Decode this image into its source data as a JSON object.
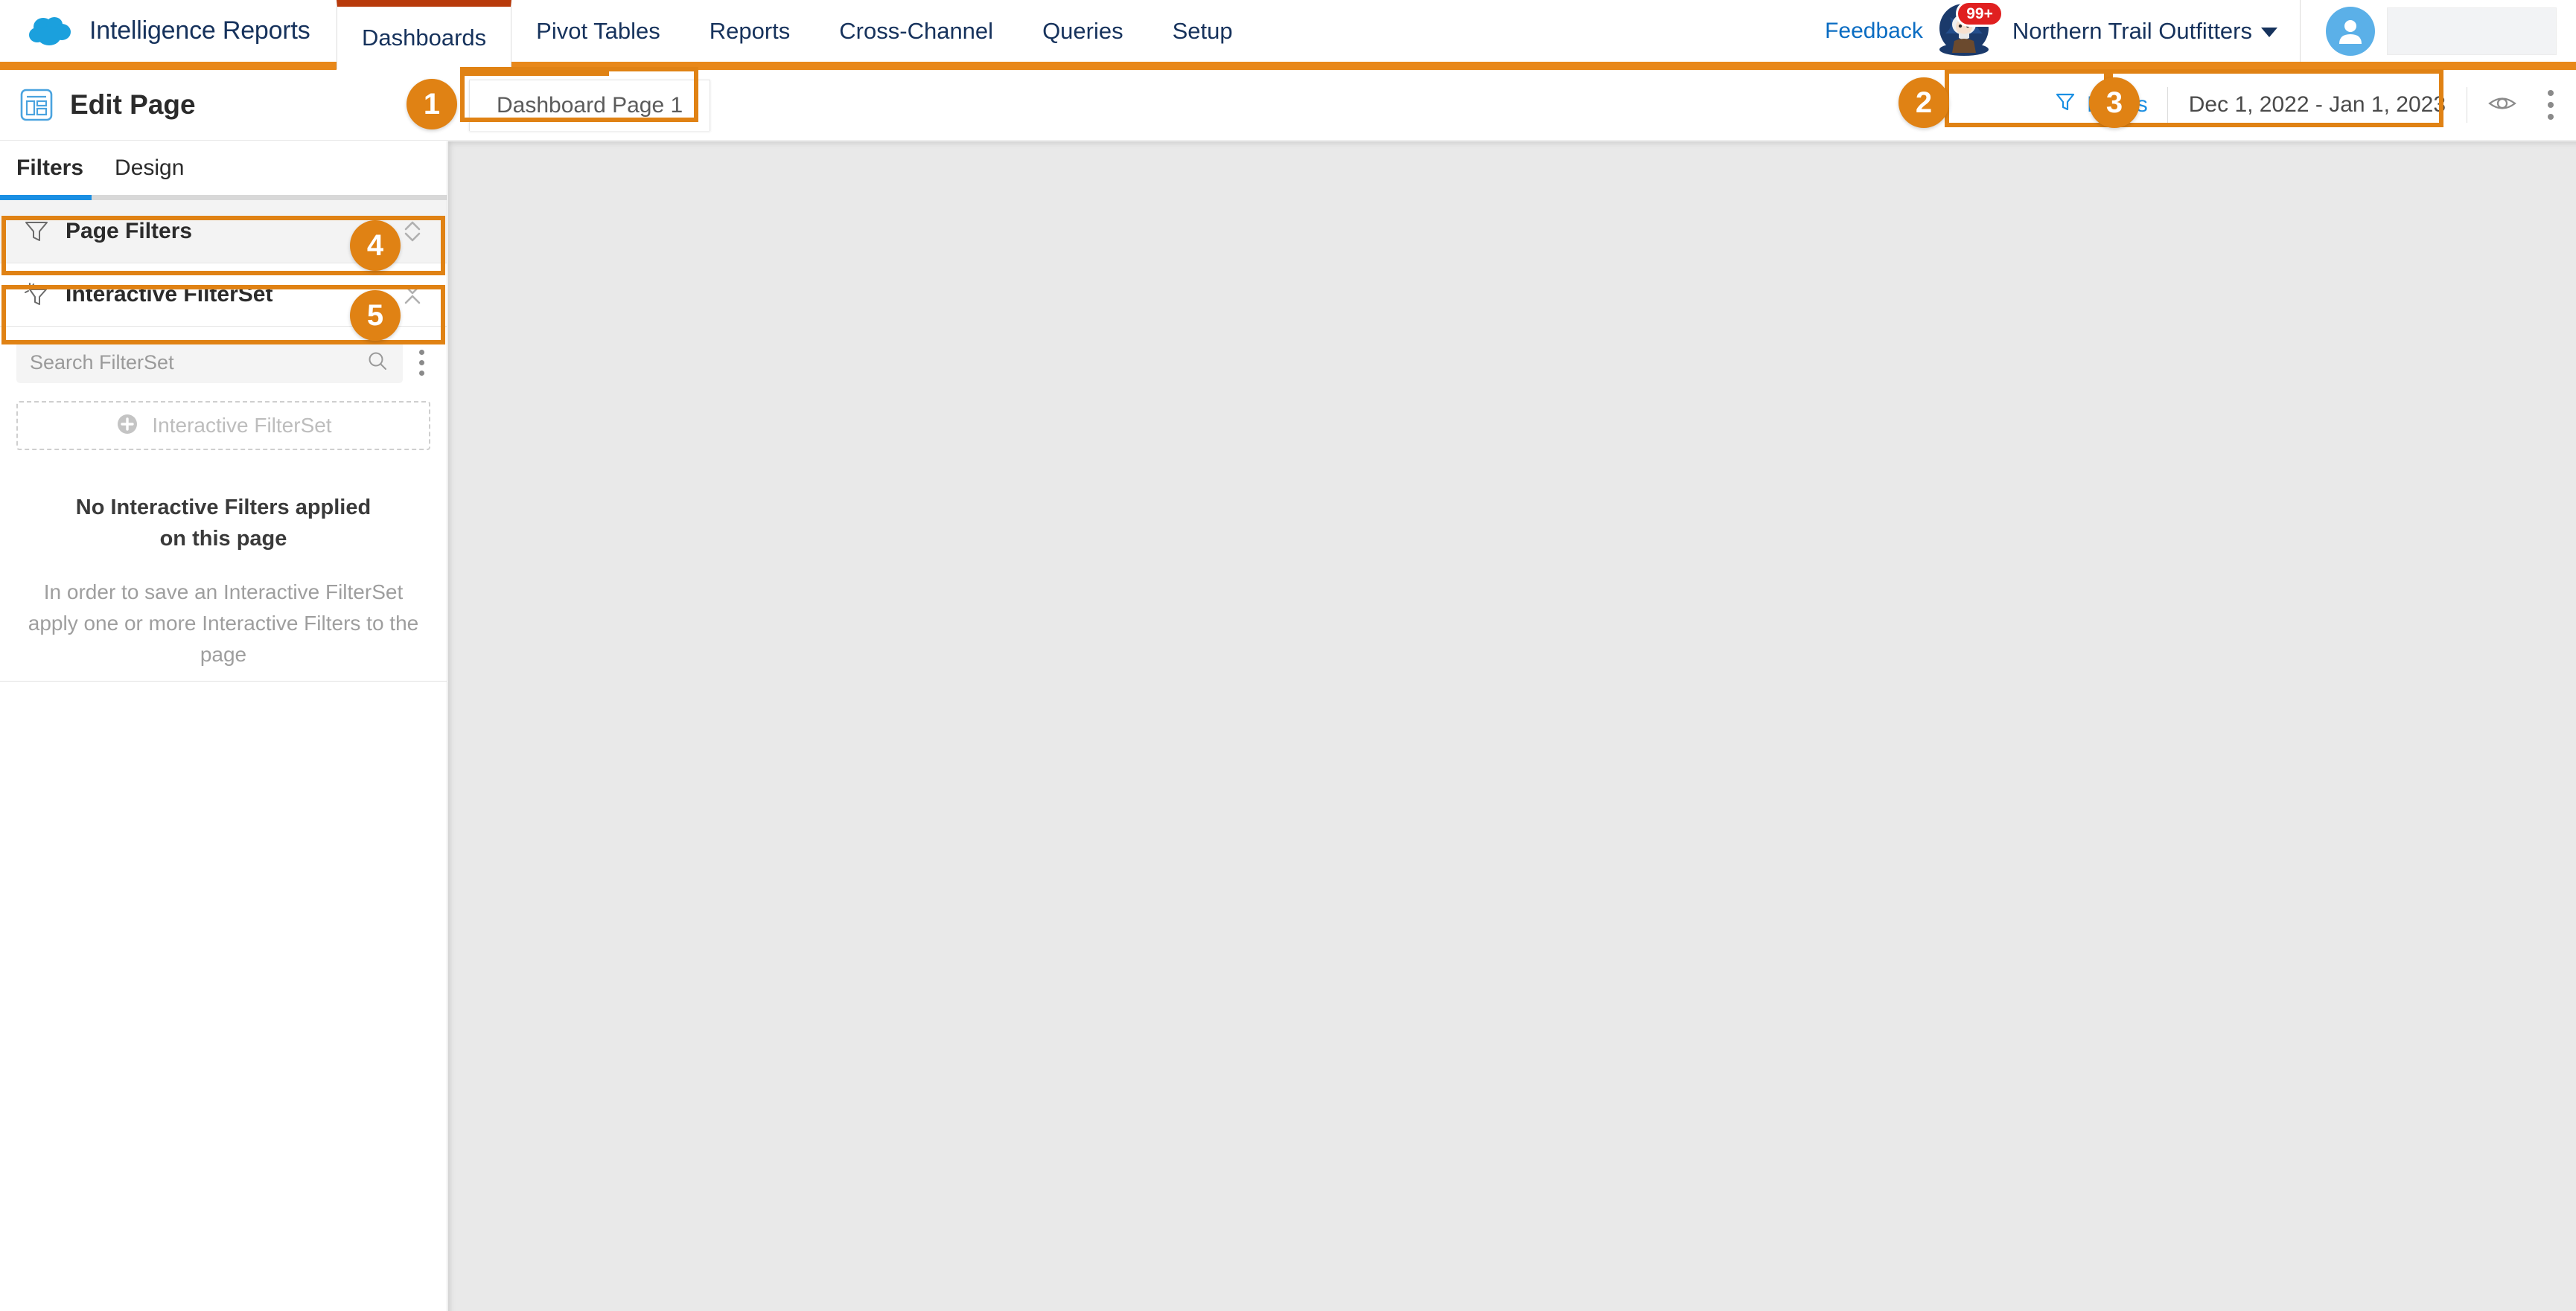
{
  "topnav": {
    "brand": "Intelligence Reports",
    "brand_logo_icon": "salesforce-cloud-icon",
    "tabs": [
      {
        "label": "Dashboards",
        "active": true
      },
      {
        "label": "Pivot Tables",
        "active": false
      },
      {
        "label": "Reports",
        "active": false
      },
      {
        "label": "Cross-Channel",
        "active": false
      },
      {
        "label": "Queries",
        "active": false
      },
      {
        "label": "Setup",
        "active": false
      }
    ],
    "feedback_label": "Feedback",
    "einstein_icon": "einstein-assistant-icon",
    "notification_badge": "99+",
    "org_name": "Northern Trail Outfitters",
    "org_caret_icon": "chevron-down-icon",
    "avatar_icon": "user-avatar-icon"
  },
  "subheader": {
    "page_icon": "page-layout-icon",
    "title": "Edit Page",
    "page_tab_label": "Dashboard Page 1",
    "filters_label": "Filters",
    "filters_icon": "funnel-icon",
    "date_range": "Dec 1, 2022 - Jan 1, 2023",
    "preview_icon": "eye-icon",
    "more_icon": "kebab-menu-icon"
  },
  "sidebar": {
    "tabs": [
      {
        "label": "Filters",
        "active": true
      },
      {
        "label": "Design",
        "active": false
      }
    ],
    "panels": [
      {
        "label": "Page Filters",
        "icon": "funnel-icon",
        "chevron_icon": "chevron-up-down-icon",
        "shaded": true
      },
      {
        "label": "Interactive FilterSet",
        "icon": "interactive-funnel-icon",
        "chevron_icon": "chevron-down-up-icon",
        "shaded": false
      }
    ],
    "search": {
      "placeholder": "Search FilterSet",
      "value": "",
      "icon": "search-icon",
      "menu_icon": "kebab-menu-icon"
    },
    "add_button": {
      "label": "Interactive FilterSet",
      "icon": "plus-circle-icon"
    },
    "empty_state": {
      "title_line1": "No Interactive Filters applied",
      "title_line2": "on this page",
      "subtitle": "In order to save an Interactive FilterSet apply one or more Interactive Filters to the page"
    }
  },
  "callouts": [
    {
      "number": "1"
    },
    {
      "number": "2"
    },
    {
      "number": "3"
    },
    {
      "number": "4"
    },
    {
      "number": "5"
    }
  ],
  "colors": {
    "accent_orange": "#e8881a",
    "callout_orange": "#e08214",
    "active_tab_border": "#b83a0b",
    "link_blue": "#0a6cc2",
    "filter_blue": "#1a8fe3",
    "nav_text": "#16325c",
    "canvas_gray": "#e9e9e9",
    "badge_red": "#e02020"
  }
}
